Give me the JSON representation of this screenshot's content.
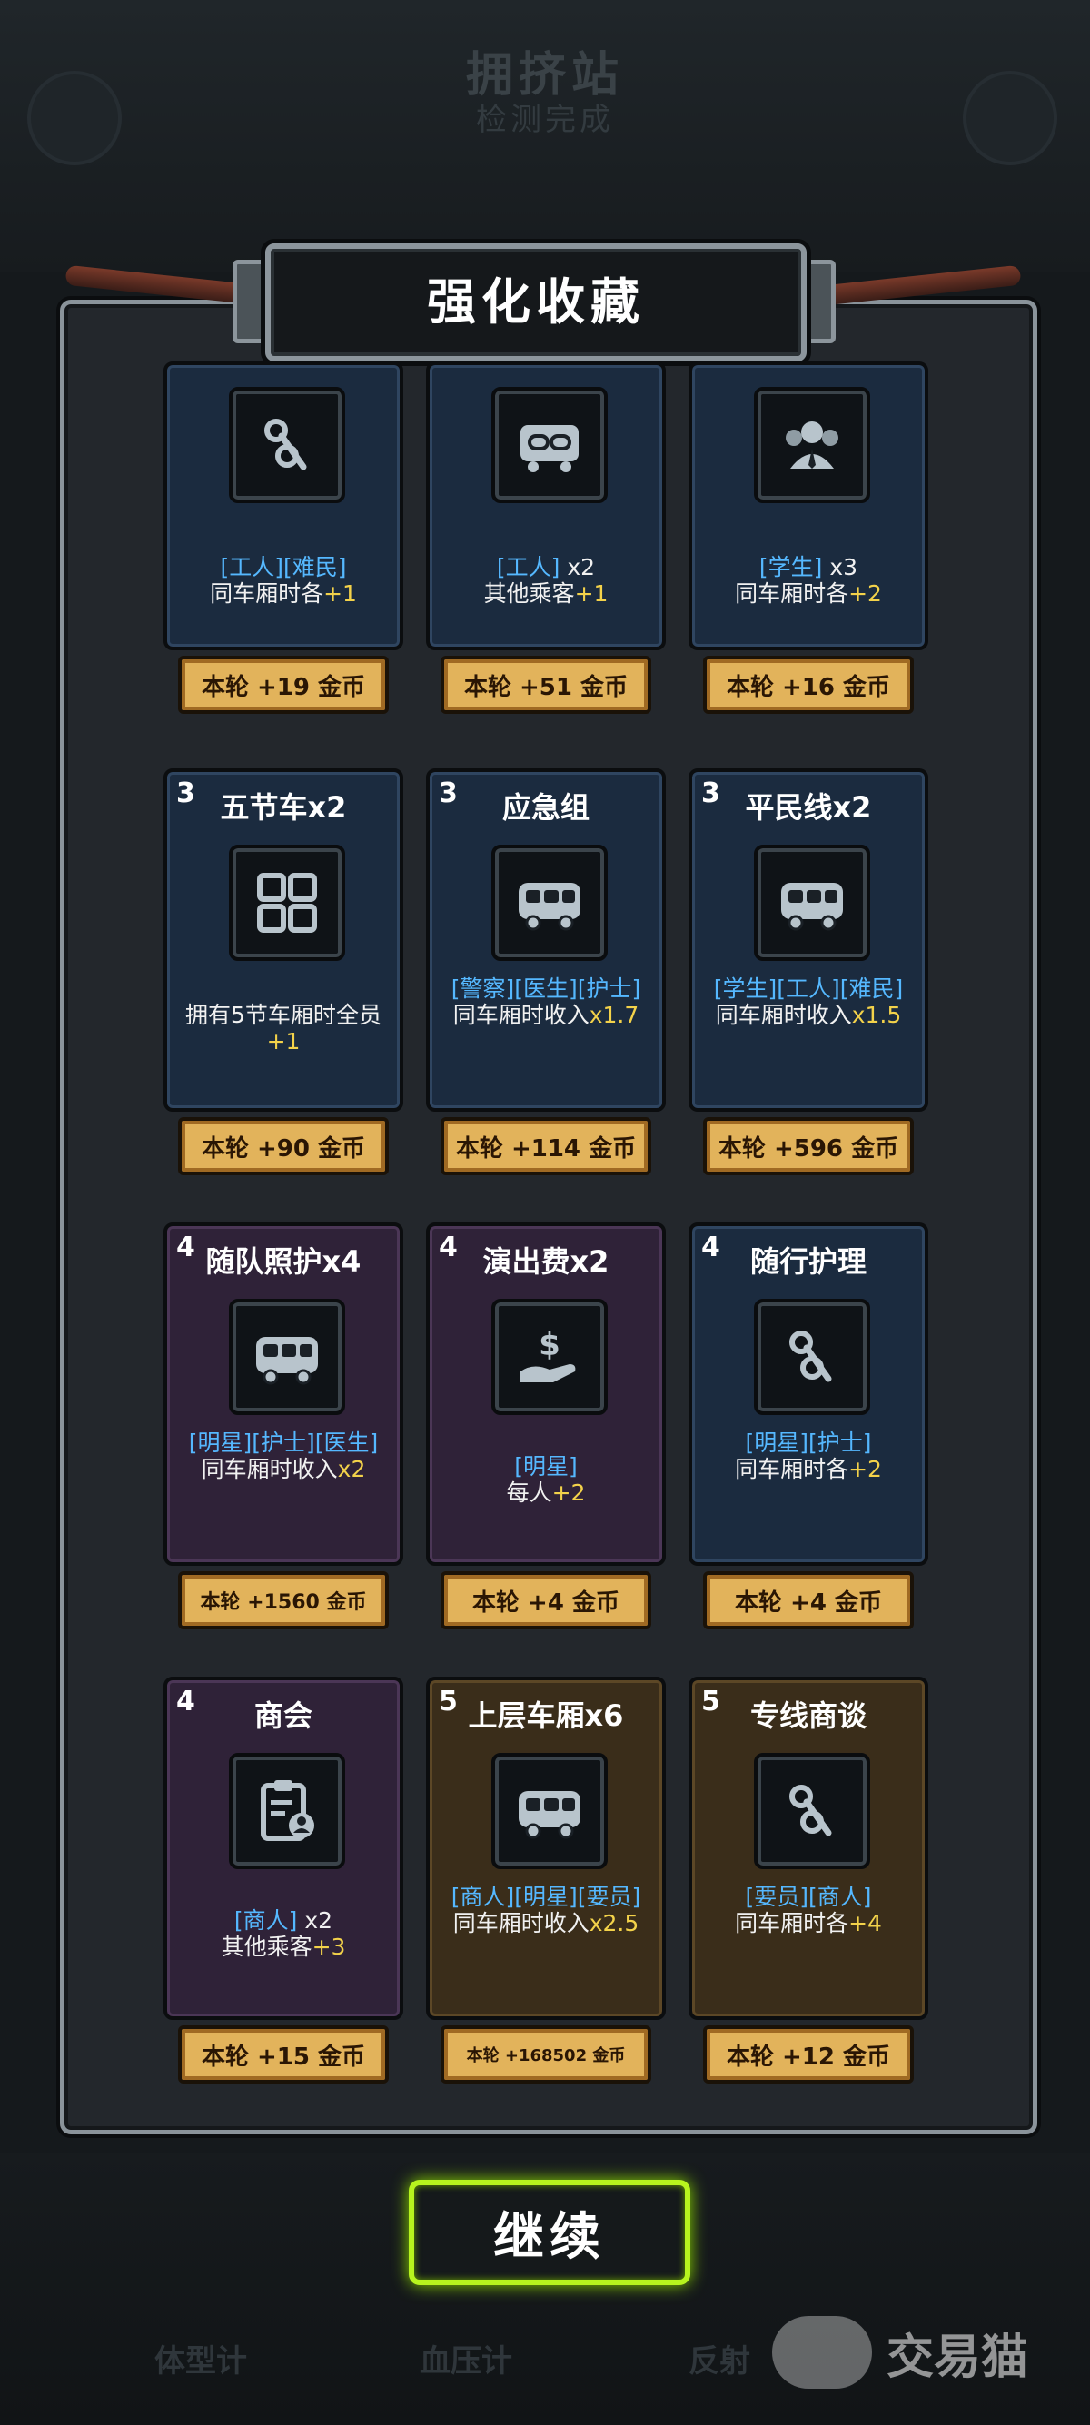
{
  "background": {
    "title": "拥挤站",
    "subtitle": "检测完成",
    "tabs": [
      "体型计",
      "血压计",
      "反射"
    ]
  },
  "header": {
    "title": "强化收藏"
  },
  "cards": [
    {
      "tier": "",
      "name": "",
      "icon": "link-knot-icon",
      "tags": "[工人][难民]",
      "mid": "",
      "text": "同车厢时各",
      "bonus": "+1",
      "reward": "本轮 +19 金币"
    },
    {
      "tier": "",
      "name": "",
      "icon": "chain-carriage-icon",
      "tags": "[工人]",
      "mid": " x2",
      "text": "其他乘客",
      "bonus": "+1",
      "reward": "本轮 +51 金币"
    },
    {
      "tier": "",
      "name": "",
      "icon": "group-people-icon",
      "tags": "[学生]",
      "mid": " x3",
      "text": "同车厢时各",
      "bonus": "+2",
      "reward": "本轮 +16 金币"
    },
    {
      "tier": "3",
      "name": "五节车x2",
      "icon": "grid-icon",
      "tags": "",
      "mid": "",
      "text": "拥有5节车厢时全员",
      "bonus": "+1",
      "reward": "本轮 +90 金币"
    },
    {
      "tier": "3",
      "name": "应急组",
      "icon": "bus-icon",
      "tags": "[警察][医生][护士]",
      "mid": "",
      "text": "同车厢时收入",
      "bonus": "x1.7",
      "reward": "本轮 +114 金币"
    },
    {
      "tier": "3",
      "name": "平民线x2",
      "icon": "bus-icon",
      "tags": "[学生][工人][难民]",
      "mid": "",
      "text": "同车厢时收入",
      "bonus": "x1.5",
      "reward": "本轮 +596 金币"
    },
    {
      "tier": "4",
      "name": "随队照护x4",
      "icon": "bus-icon",
      "tags": "[明星][护士][医生]",
      "mid": "",
      "text": "同车厢时收入",
      "bonus": "x2",
      "reward": "本轮 +1560 金币"
    },
    {
      "tier": "4",
      "name": "演出费x2",
      "icon": "money-hand-icon",
      "tags": "[明星]",
      "mid": "",
      "text": "每人",
      "bonus": "+2",
      "reward": "本轮 +4 金币"
    },
    {
      "tier": "4",
      "name": "随行护理",
      "icon": "link-knot-icon",
      "tags": "[明星][护士]",
      "mid": "",
      "text": "同车厢时各",
      "bonus": "+2",
      "reward": "本轮 +4 金币"
    },
    {
      "tier": "4",
      "name": "商会",
      "icon": "clipboard-user-icon",
      "tags": "[商人]",
      "mid": " x2",
      "text": "其他乘客",
      "bonus": "+3",
      "reward": "本轮 +15 金币"
    },
    {
      "tier": "5",
      "name": "上层车厢x6",
      "icon": "bus-icon",
      "tags": "[商人][明星][要员]",
      "mid": "",
      "text": "同车厢时收入",
      "bonus": "x2.5",
      "reward": "本轮 +168502 金币"
    },
    {
      "tier": "5",
      "name": "专线商谈",
      "icon": "link-knot-icon",
      "tags": "[要员][商人]",
      "mid": "",
      "text": "同车厢时各",
      "bonus": "+4",
      "reward": "本轮 +12 金币"
    }
  ],
  "continue_button": "继续",
  "watermark": "交易猫"
}
